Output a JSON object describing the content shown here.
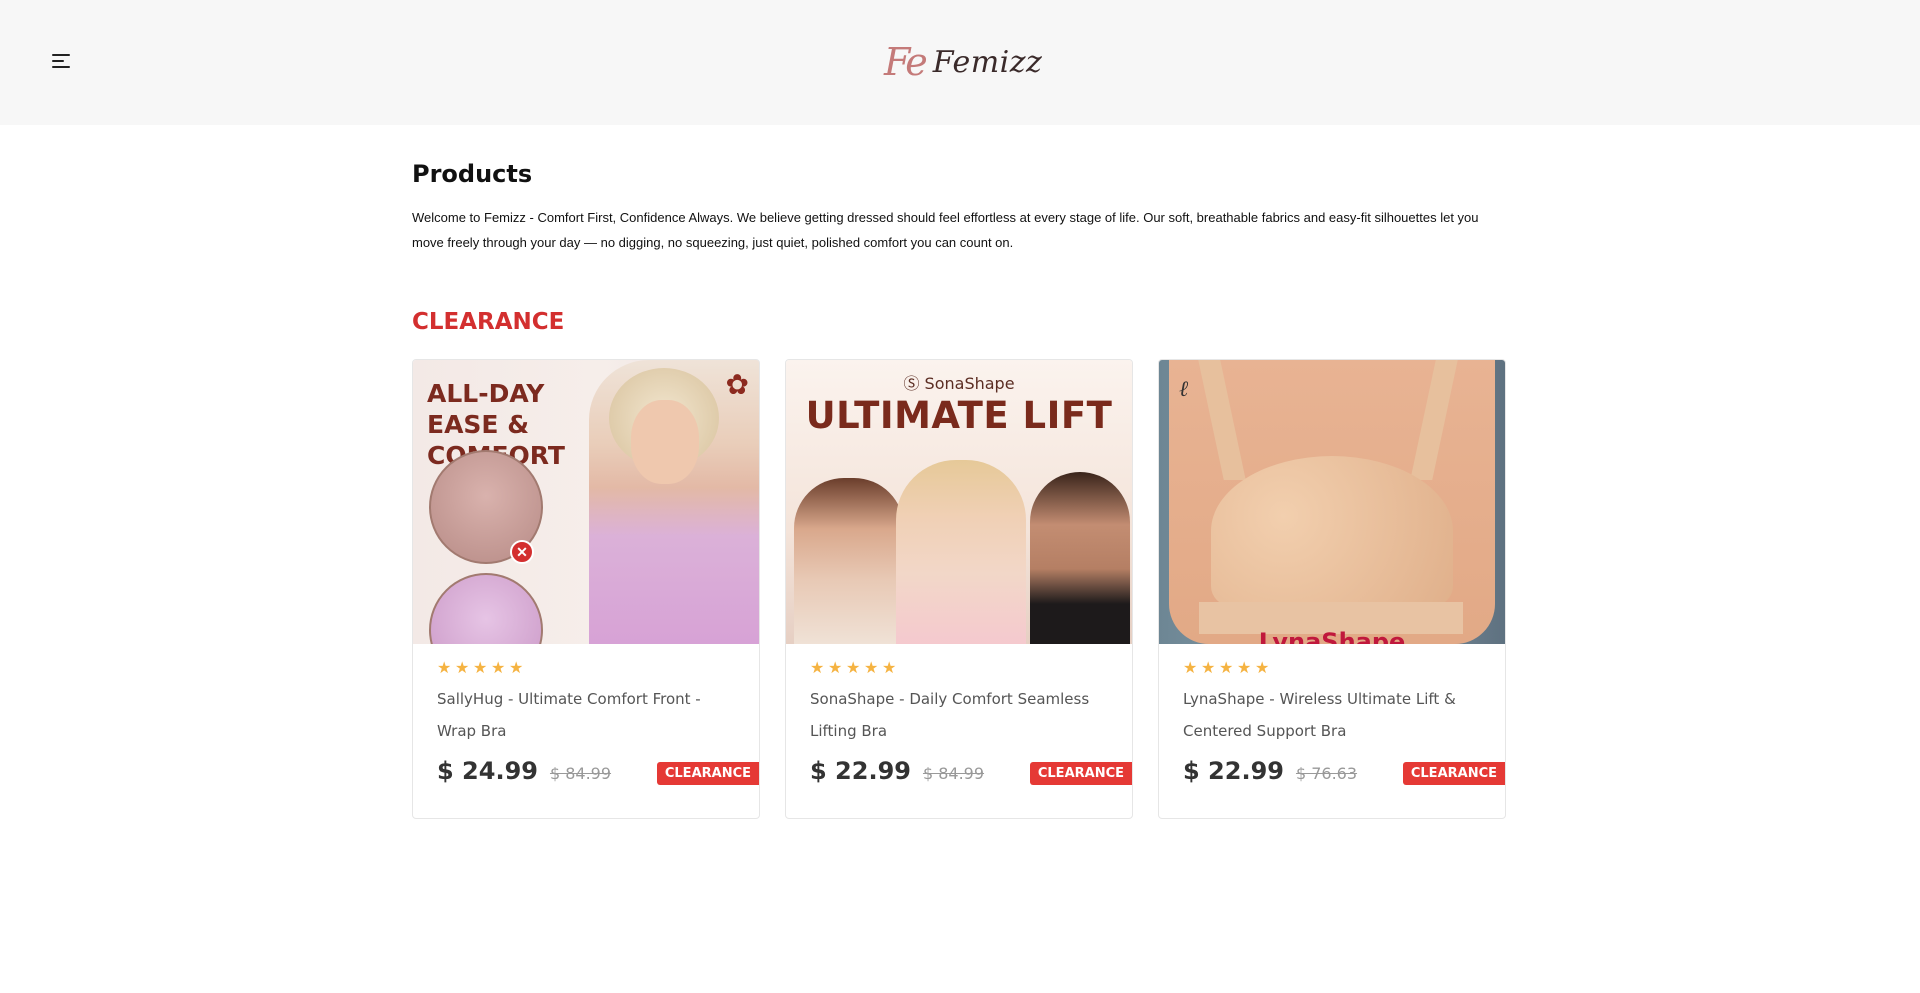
{
  "header": {
    "logo_mark": "Fe",
    "logo_text": "Femizz"
  },
  "main": {
    "title": "Products",
    "intro": "Welcome to Femizz - Comfort First, Confidence Always. We believe getting dressed should feel effortless at every stage of life. Our soft, breathable fabrics and easy-fit silhouettes let you move freely through your day — no digging, no squeezing, just quiet, polished comfort you can count on.",
    "section_title": "CLEARANCE"
  },
  "products": [
    {
      "name": "SallyHug - Ultimate Comfort Front - Wrap Bra",
      "price": "$ 24.99",
      "old_price": "$ 84.99",
      "badge": "CLEARANCE",
      "rating": 5,
      "image_headline": "ALL-DAY EASE & COMFORT"
    },
    {
      "name": "SonaShape - Daily Comfort Seamless Lifting Bra",
      "price": "$ 22.99",
      "old_price": "$ 84.99",
      "badge": "CLEARANCE",
      "rating": 5,
      "image_brand": "SonaShape",
      "image_headline": "ULTIMATE LIFT"
    },
    {
      "name": "LynaShape - Wireless Ultimate Lift & Centered Support Bra",
      "price": "$ 22.99",
      "old_price": "$ 76.63",
      "badge": "CLEARANCE",
      "rating": 5,
      "image_brand": "LynaShape"
    }
  ],
  "colors": {
    "accent_red": "#d32f2f",
    "badge_red": "#e53935",
    "star": "#f5b342",
    "header_bg": "#f7f7f7"
  }
}
